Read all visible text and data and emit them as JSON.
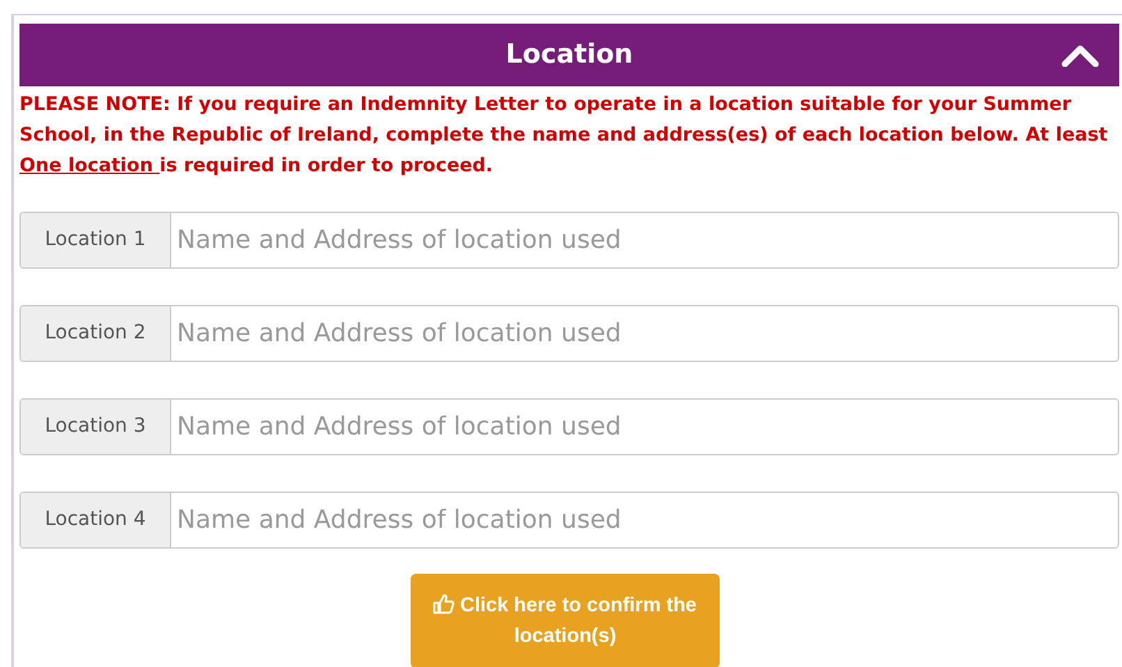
{
  "panel": {
    "title": "Location",
    "expanded": true
  },
  "note": {
    "before": "PLEASE NOTE: If you require an Indemnity Letter to operate in a location suitable for your Summer School, in the Republic of Ireland, complete the name and address(es) of each location below. At least ",
    "link": "One location ",
    "after": "is required in order to proceed."
  },
  "locations": [
    {
      "label": "Location 1",
      "placeholder": "Name and Address of location used"
    },
    {
      "label": "Location 2",
      "placeholder": "Name and Address of location used"
    },
    {
      "label": "Location 3",
      "placeholder": "Name and Address of location used"
    },
    {
      "label": "Location 4",
      "placeholder": "Name and Address of location used"
    }
  ],
  "confirm_button": "Click here to confirm the location(s)"
}
